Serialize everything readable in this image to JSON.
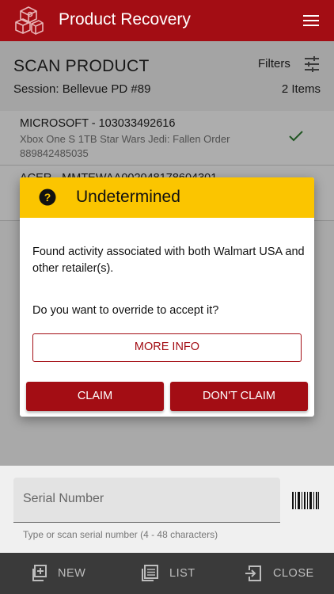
{
  "app": {
    "title": "Product Recovery"
  },
  "header": {
    "title": "SCAN PRODUCT",
    "filters_label": "Filters",
    "session": "Session: Bellevue PD #89",
    "item_count": "2 Items"
  },
  "items": [
    {
      "title": "MICROSOFT - 103033492616",
      "description": "Xbox One S 1TB Star Wars Jedi: Fallen Order",
      "code": "889842485035",
      "status_icon": "check-icon"
    },
    {
      "title": "ACER - MMTEWAA002048178604301",
      "description": "",
      "code": "",
      "status_icon": ""
    }
  ],
  "dialog": {
    "title": "Undetermined",
    "message": "Found activity associated with both Walmart USA and other retailer(s).",
    "question": "Do you want to override to accept it?",
    "more_info_label": "MORE INFO",
    "claim_label": "CLAIM",
    "dont_claim_label": "DON'T CLAIM",
    "header_color": "#fbc500"
  },
  "serial": {
    "placeholder": "Serial Number",
    "helper": "Type or scan serial number (4 - 48 characters)"
  },
  "bottom_nav": {
    "new_label": "NEW",
    "list_label": "LIST",
    "close_label": "CLOSE"
  },
  "colors": {
    "brand": "#a30d14",
    "accent": "#fbc500",
    "success": "#2e7d32"
  }
}
